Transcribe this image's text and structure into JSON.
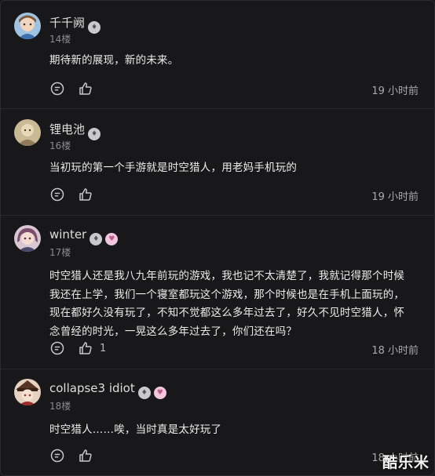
{
  "comments": [
    {
      "author": "千千阙",
      "floor": "14楼",
      "text": "期待新的展现，新的未来。",
      "time": "19 小时前",
      "likes": "",
      "badges": [
        "grey"
      ]
    },
    {
      "author": "锂电池",
      "floor": "16楼",
      "text": "当初玩的第一个手游就是时空猎人，用老妈手机玩的",
      "time": "19 小时前",
      "likes": "",
      "badges": [
        "grey"
      ]
    },
    {
      "author": "winter",
      "floor": "17楼",
      "text": "时空猎人还是我八九年前玩的游戏，我也记不太清楚了，我就记得那个时候我还在上学，我们一个寝室都玩这个游戏，那个时候也是在手机上面玩的，现在都好久没有玩了，不知不觉都这么多年过去了，好久不见时空猎人，怀念曾经的时光，一晃这么多年过去了，你们还在吗？",
      "time": "18 小时前",
      "likes": "1",
      "badges": [
        "grey",
        "pink"
      ]
    },
    {
      "author": "collapse3 idiot",
      "floor": "18楼",
      "text": "时空猎人……唉，当时真是太好玩了",
      "time": "18 小时前",
      "likes": "",
      "badges": [
        "grey",
        "pink"
      ]
    }
  ],
  "watermark": "酷乐米",
  "icons": {
    "comment": "comment-bubble-icon",
    "like": "thumbs-up-icon",
    "badge_grey": "level-badge-icon",
    "badge_pink": "fan-badge-icon"
  },
  "colors": {
    "background": "#18181a",
    "text": "#ececec",
    "muted": "#8b8b90"
  }
}
